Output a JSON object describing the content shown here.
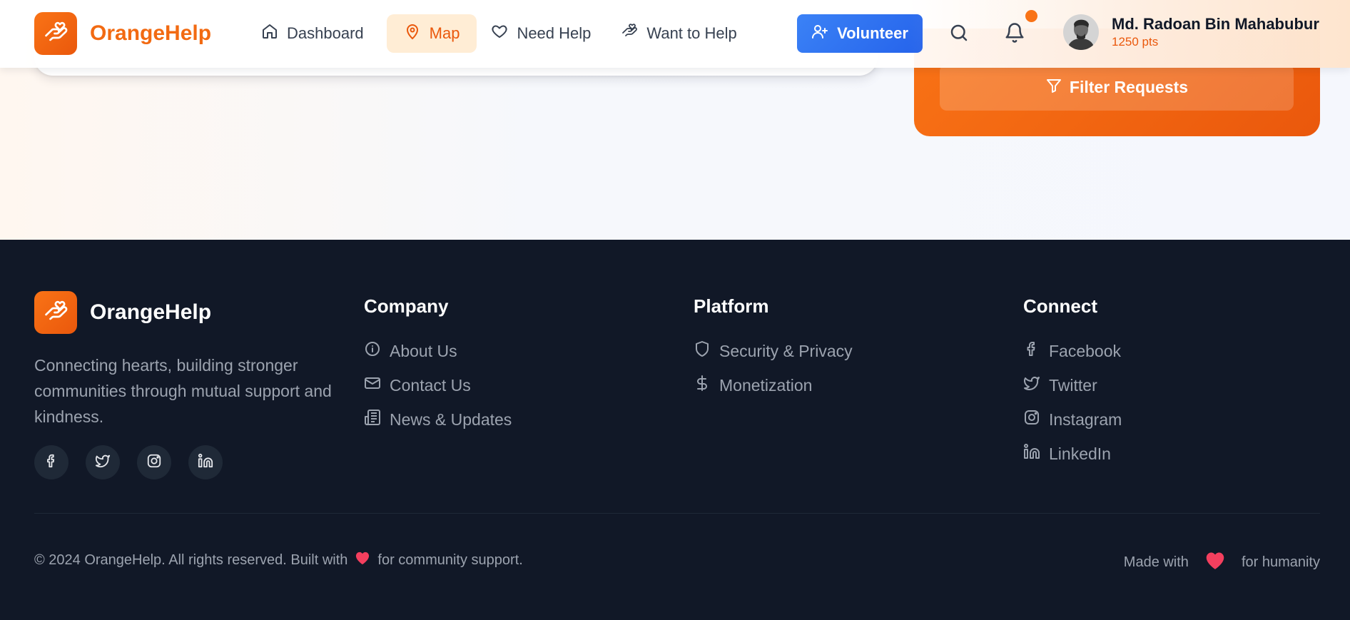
{
  "header": {
    "brand": "OrangeHelp",
    "nav": [
      {
        "label": "Dashboard",
        "icon": "home-icon",
        "active": false
      },
      {
        "label": "Map",
        "icon": "map-pin-icon",
        "active": true
      },
      {
        "label": "Need Help",
        "icon": "heart-icon",
        "active": false
      },
      {
        "label": "Want to Help",
        "icon": "hand-heart-icon",
        "active": false
      }
    ],
    "volunteer_label": "Volunteer",
    "user": {
      "name": "Md. Radoan Bin Mahabubur",
      "points": "1250 pts"
    }
  },
  "filter_panel": {
    "button_label": "Filter Requests"
  },
  "footer": {
    "brand": "OrangeHelp",
    "description": "Connecting hearts, building stronger communities through mutual support and kindness.",
    "social_icons": [
      "facebook-icon",
      "twitter-icon",
      "instagram-icon",
      "linkedin-icon"
    ],
    "company": {
      "title": "Company",
      "links": [
        "About Us",
        "Contact Us",
        "News & Updates"
      ]
    },
    "platform": {
      "title": "Platform",
      "links": [
        "Security & Privacy",
        "Monetization"
      ]
    },
    "connect": {
      "title": "Connect",
      "links": [
        "Facebook",
        "Twitter",
        "Instagram",
        "LinkedIn"
      ]
    },
    "copyright_before": "© 2024 OrangeHelp. All rights reserved. Built with",
    "copyright_after": "for community support.",
    "made_with_before": "Made with",
    "made_with_after": "for humanity"
  },
  "colors": {
    "brand_orange": "#f97316",
    "accent_blue": "#2563eb",
    "footer_bg": "#111827",
    "heart": "#f43f5e"
  }
}
